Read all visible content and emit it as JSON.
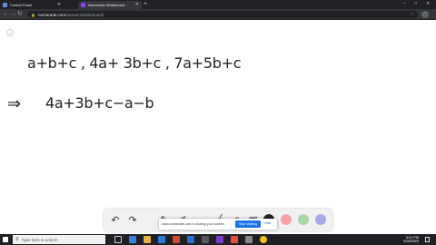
{
  "browser": {
    "tabs": [
      {
        "title": "Control Panel",
        "favicon_color": "#5b8def",
        "active": false
      },
      {
        "title": "Numerade Whiteboard",
        "favicon_color": "#8a3ffc",
        "active": true
      }
    ],
    "new_tab_icon": "plus-icon",
    "url_host": "numerade.com",
    "url_path": "/answers/whiteboard/"
  },
  "whiteboard": {
    "page_indicator": "1",
    "line1": "a+b+c ,  4a+ 3b+c ,  7a+5b+c",
    "arrow": "⇒",
    "line2": "4a+3b+c−a−b"
  },
  "toolbar": {
    "tools": [
      "undo-icon",
      "redo-icon",
      "pen-icon",
      "marker-icon",
      "eraser-icon",
      "line-icon",
      "shapes-icon",
      "image-icon"
    ],
    "colors": [
      "#222222",
      "#f4a3a3",
      "#a9d6a9",
      "#a9a9e6"
    ]
  },
  "share_banner": {
    "message": "www.numerade.com is sharing your screen.",
    "stop_label": "Stop sharing",
    "hide_label": "Hide"
  },
  "taskbar": {
    "search_placeholder": "Type here to search",
    "time": "9:01 PM",
    "date": "3/26/2020"
  }
}
